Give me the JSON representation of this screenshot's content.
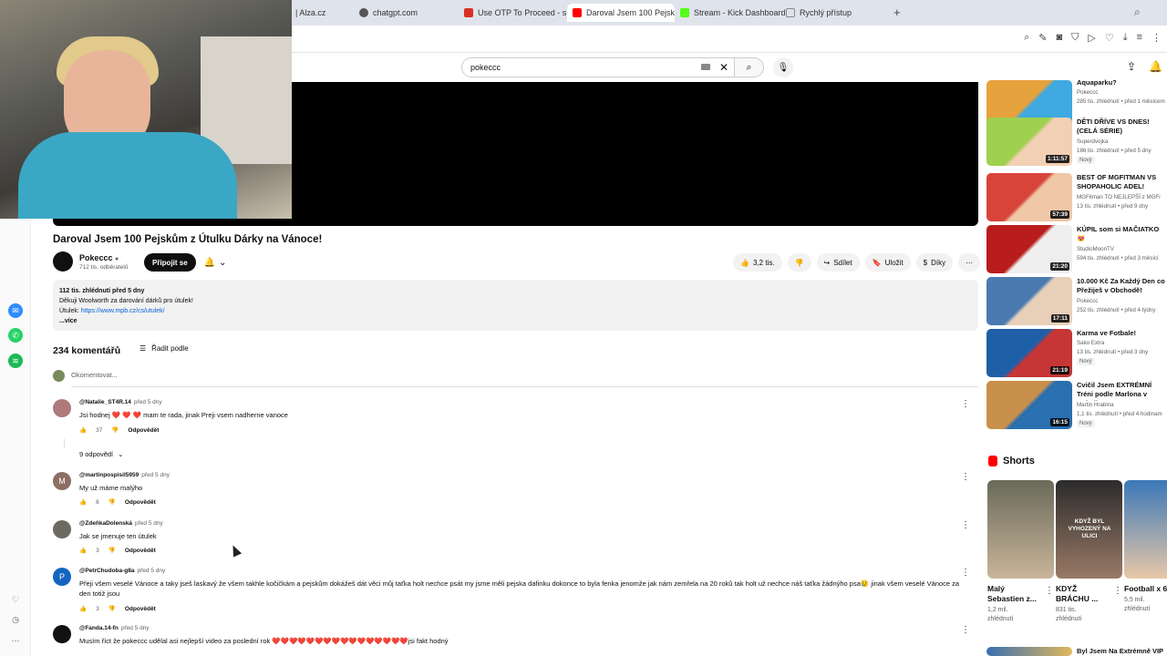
{
  "browser": {
    "tabs": [
      {
        "label": "| Alza.cz",
        "color": "#1a3a8a"
      },
      {
        "label": "chatgpt.com",
        "color": "#555555"
      },
      {
        "label": "Use OTP To Proceed - sib",
        "color": "#d93025"
      },
      {
        "label": "Daroval Jsem 100 Pejskům",
        "color": "#ff0000"
      },
      {
        "label": "Stream - Kick Dashboard",
        "color": "#53fc18"
      },
      {
        "label": "Rychlý přístup",
        "color": "#888888"
      }
    ],
    "new_tab": "+"
  },
  "youtube": {
    "search_value": "pokeccc",
    "video": {
      "title": "Daroval Jsem 100 Pejskům z Útulku Dárky na Vánoce!",
      "channel": "Pokeccc",
      "subscribers": "712 tis. odběratelů",
      "subscribe_label": "Připojit se",
      "likes": "3,2 tis.",
      "share_label": "Sdílet",
      "save_label": "Uložit",
      "thanks_label": "Díky"
    },
    "description": {
      "stats": "112 tis. zhlédnutí  před 5 dny",
      "line1": "Děkuji Woolworth za darování dárků pro útulek!",
      "line2_prefix": "Útulek: ",
      "link": "https://www.mpb.cz/cs/utulek/",
      "more": "...více"
    },
    "comments_header": {
      "count": "234 komentářů",
      "sort_label": "Řadit podle",
      "add_placeholder": "Okomentovat..."
    },
    "reply_label": "Odpovědět",
    "comments": [
      {
        "author": "@Natalie_ST4R.14",
        "age": "před 5 dny",
        "text": "Jsi hodnej ❤️ ❤️ ❤️  mam te rada, jinak Preji vsem nadherne vanoce",
        "likes": "37",
        "avatar_color": "#b07a7a",
        "avatar_letter": ""
      },
      {
        "author": "@martinpospisil5959",
        "age": "před 5 dny",
        "text": "My už máme malýho",
        "likes": "6",
        "avatar_color": "#8d6e63",
        "avatar_letter": "M"
      },
      {
        "author": "@ZdeňkaDolenská",
        "age": "před 5 dny",
        "text": "Jak se jmenuje ten útulek",
        "likes": "3",
        "avatar_color": "#6d6a62",
        "avatar_letter": ""
      },
      {
        "author": "@PetrChudoba-g8a",
        "age": "před 5 dny",
        "text": "Přeji všem veselé Vánoce a taky jseš laskavý že všem takhle kočičkám a pejskům dokážeš dát věci můj taťka holt nechce psát my jsme měli pejska  dafinku dokonce to byla fenka jenomže jak nám zemřela na 20 roků tak holt už nechce náš taťka žádnýho psa😢 jinak všem veselé Vánoce za den totiž jsou",
        "likes": "3",
        "avatar_color": "#1565c0",
        "avatar_letter": "P"
      },
      {
        "author": "@Fanda.14-fn",
        "age": "před 5 dny",
        "text": "Musím říct že pokeccc udělal asi nejlepší video za poslední  rok ❤️❤️❤️❤️❤️❤️❤️❤️❤️❤️❤️❤️❤️❤️❤️❤️jsi fakt hodný",
        "likes": "",
        "avatar_color": "#111111",
        "avatar_letter": ""
      }
    ],
    "replies_toggle": "9 odpovědí",
    "recommended": [
      {
        "title": "Aquaparku?",
        "channel": "Pokeccc",
        "meta": "285 tis. zhlédnutí • před 1 měsícem",
        "duration": "14:34",
        "new": "",
        "thumb_a": "#e6a23c",
        "thumb_b": "#3fa9e0"
      },
      {
        "title": "DĚTI DŘÍVE VS DNES! (CELÁ SÉRIE)",
        "channel": "Superdvojka",
        "meta": "186 tis. zhlédnutí • před 5 dny",
        "duration": "1:11:57",
        "new": "Nový",
        "thumb_a": "#9fd04f",
        "thumb_b": "#f2d0b4"
      },
      {
        "title": "BEST OF MGFITMAN VS SHOPAHOLIC ADEL!",
        "channel": "MGFitman TO NEJLEPŠÍ z MGFi",
        "meta": "13 tis. zhlédnutí • před 9 dny",
        "duration": "57:39",
        "new": "",
        "thumb_a": "#d9443a",
        "thumb_b": "#f0c8a8"
      },
      {
        "title": "KÚPIL som si MAČIATKO 😻",
        "channel": "StudioMoonTV",
        "meta": "594 tis. zhlédnutí • před 3 měsíci",
        "duration": "21:20",
        "new": "",
        "thumb_a": "#b91c1c",
        "thumb_b": "#eeeeee"
      },
      {
        "title": "10.000 Kč Za Každý Den co Přežiješ v Obchodě!",
        "channel": "Pokeccc",
        "meta": "252 tis. zhlédnutí • před 4 týdny",
        "duration": "17:11",
        "new": "",
        "thumb_a": "#4a7ab0",
        "thumb_b": "#e8d0b8"
      },
      {
        "title": "Karma ve Fotbale!",
        "channel": "Sako Extra",
        "meta": "13 tis. zhlédnutí • před 3 dny",
        "duration": "21:19",
        "new": "Nový",
        "thumb_a": "#1f5fa8",
        "thumb_b": "#c73636"
      },
      {
        "title": "Cvičil Jsem EXTRÉMNÍ Tréni podle Marlona v Dubaji a TO",
        "channel": "Martin Hrabina",
        "meta": "1,1 tis. zhlédnutí • před 4 hodinam",
        "duration": "16:15",
        "new": "Nový",
        "thumb_a": "#c8904a",
        "thumb_b": "#2a6fb0"
      }
    ],
    "shorts_label": "Shorts",
    "shorts": [
      {
        "title": "Malý Sebastien z...",
        "views": "1,2 mil. zhlédnutí",
        "thumb_a": "#6a6a5a",
        "thumb_b": "#c9b59a",
        "overlay": ""
      },
      {
        "title": "KDYŽ BRÁCHU ...",
        "views": "831 tis. zhlédnutí",
        "thumb_a": "#2b2b2b",
        "thumb_b": "#9a7a66",
        "overlay": "KDYŽ BYL VYHOZENÝ NA ULICI"
      },
      {
        "title": "Football x 6 ⚽️🥲⁷",
        "views": "5,5 mil. zhlédnutí",
        "thumb_a": "#3a78b8",
        "thumb_b": "#e8c8a8",
        "overlay": ""
      }
    ],
    "bottom_rec": "Byl Jsem Na Extrémně VIP"
  }
}
